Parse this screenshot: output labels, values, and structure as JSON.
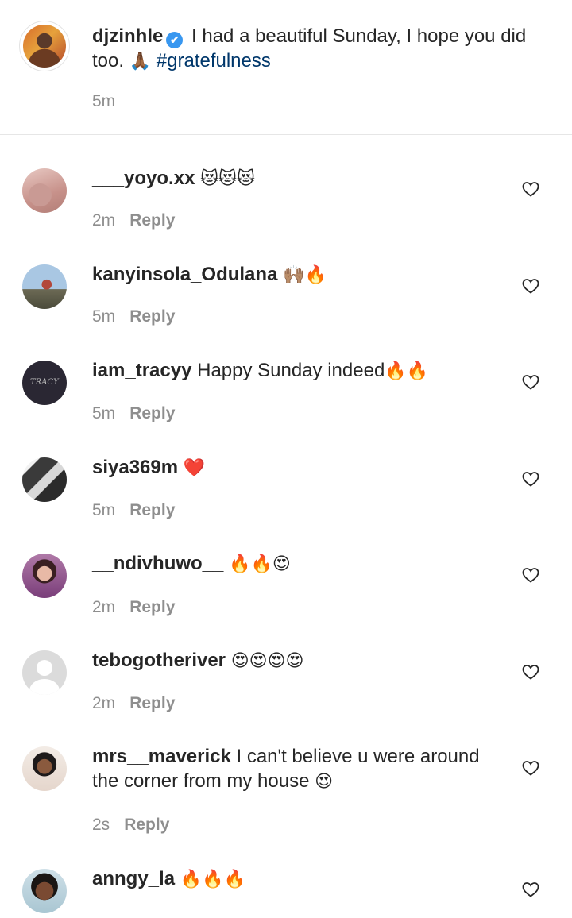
{
  "post": {
    "username": "djzinhle",
    "verified_mark": "✔",
    "caption": "I had a beautiful Sunday, I hope you did too.",
    "caption_emoji": "🙏🏾",
    "hashtag": "#gratefulness",
    "time": "5m"
  },
  "reply_label": "Reply",
  "like_icon": "heart-outline-icon",
  "comments": [
    {
      "username": "___yoyo.xx",
      "text": "",
      "emoji": "😻😻😻",
      "time": "2m"
    },
    {
      "username": "kanyinsola_Odulana",
      "text": "",
      "emoji": "🙌🏽🔥",
      "time": "5m"
    },
    {
      "username": "iam_tracyy",
      "text": "Happy Sunday indeed",
      "emoji": "🔥🔥",
      "time": "5m"
    },
    {
      "username": "siya369m",
      "text": "",
      "emoji": "❤️",
      "time": "5m"
    },
    {
      "username": "__ndivhuwo__",
      "text": "",
      "emoji": "🔥🔥😍",
      "time": "2m"
    },
    {
      "username": "tebogotheriver",
      "text": "",
      "emoji": "😍😍😍😍",
      "time": "2m"
    },
    {
      "username": "mrs__maverick",
      "text": "I can't believe u were around the corner from my house",
      "emoji": "😍",
      "time": "2s"
    },
    {
      "username": "anngy_la",
      "text": "",
      "emoji": "🔥🔥🔥",
      "time": ""
    }
  ]
}
